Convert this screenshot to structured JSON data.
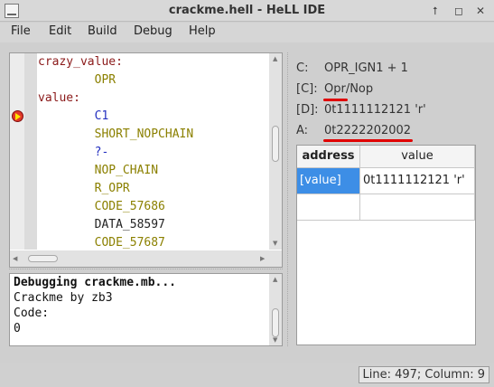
{
  "window": {
    "title": "crackme.hell - HeLL IDE",
    "buttons": {
      "up": "⭡",
      "restore": "◻",
      "close": "✕"
    }
  },
  "menu": {
    "items": [
      "File",
      "Edit",
      "Build",
      "Debug",
      "Help"
    ]
  },
  "editor": {
    "lines": [
      {
        "text": "crazy_value:",
        "kind": "label"
      },
      {
        "text": "        OPR",
        "kind": "op"
      },
      {
        "text": "value:",
        "kind": "label"
      },
      {
        "text": "        C1",
        "kind": "blue"
      },
      {
        "text": "        SHORT_NOPCHAIN",
        "kind": "op"
      },
      {
        "text": "        ?-",
        "kind": "blue"
      },
      {
        "text": "        NOP_CHAIN",
        "kind": "op"
      },
      {
        "text": "        R_OPR",
        "kind": "op"
      },
      {
        "text": "        CODE_57686",
        "kind": "op"
      },
      {
        "text": "        DATA_58597",
        "kind": "plain"
      },
      {
        "text": "        CODE_57687",
        "kind": "op"
      }
    ],
    "breakpoint_icon": "current-line-arrow-icon"
  },
  "console": {
    "lines": [
      "Debugging crackme.mb...",
      "Crackme by zb3",
      "Code:",
      "0"
    ]
  },
  "registers": {
    "c_label": "C:",
    "c_value": "OPR_IGN1 + 1",
    "ci_label": "[C]:",
    "ci_value": "Opr/Nop",
    "d_label": "[D]:",
    "d_value": "0t1111112121 'r'",
    "a_label": "A:",
    "a_value": "0t2222202002"
  },
  "memory_table": {
    "headers": [
      "address",
      "value"
    ],
    "rows": [
      [
        "[value]",
        "0t1111112121 'r'"
      ],
      [
        "",
        ""
      ]
    ]
  },
  "status": {
    "text": "Line: 497; Column: 9"
  },
  "colors": {
    "label": "#8b1a1a",
    "op": "#8b8000",
    "blue": "#2430c0",
    "selection": "#3d8ee6",
    "underline": "#e00000"
  }
}
